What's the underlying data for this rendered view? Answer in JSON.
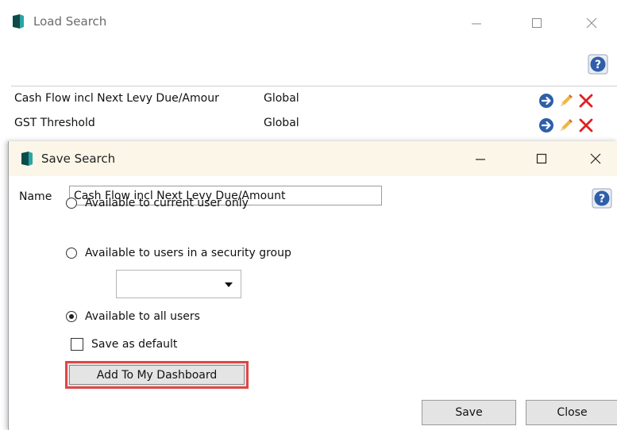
{
  "load_window": {
    "title": "Load Search",
    "controls": [
      "minimize-icon",
      "maximize-icon",
      "close-icon"
    ],
    "help_icon": "help-icon",
    "searches": [
      {
        "name": "Cash Flow incl Next Levy Due/Amour",
        "scope": "Global",
        "actions": [
          "go-icon",
          "edit-icon",
          "delete-icon"
        ]
      },
      {
        "name": "GST Threshold",
        "scope": "Global",
        "actions": [
          "go-icon",
          "edit-icon",
          "delete-icon"
        ]
      }
    ]
  },
  "save_dialog": {
    "title": "Save Search",
    "name_label": "Name",
    "name_value": "Cash Flow incl Next Levy Due/Amount",
    "options": {
      "current_user": "Available to current user only",
      "security_group": "Available to users in a security group",
      "all_users": "Available to all users",
      "selected": "all_users"
    },
    "security_group_value": "",
    "save_as_default_label": "Save as default",
    "save_as_default_checked": false,
    "dashboard_button": "Add To My Dashboard",
    "save_button": "Save",
    "close_button": "Close"
  },
  "colors": {
    "dialog_titlebar": "#fbf6e8",
    "highlight_border": "#e04646",
    "go_icon": "#2f5fa8",
    "edit_icon": "#e0a020",
    "delete_icon": "#e02020",
    "help_icon": "#2f5fa8"
  }
}
